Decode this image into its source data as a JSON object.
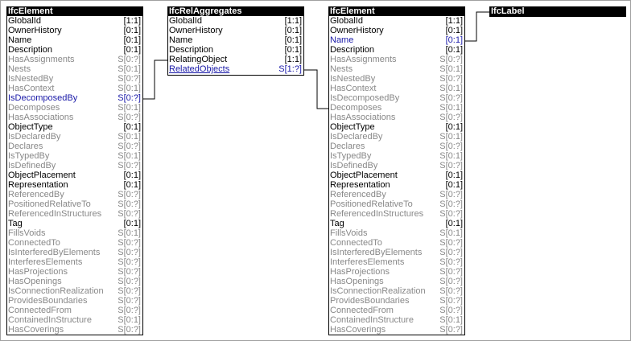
{
  "entities": [
    {
      "name": "IfcElement",
      "attributes": [
        {
          "name": "GlobalId",
          "card": "[1:1]",
          "kind": "direct"
        },
        {
          "name": "OwnerHistory",
          "card": "[0:1]",
          "kind": "direct"
        },
        {
          "name": "Name",
          "card": "[0:1]",
          "kind": "direct"
        },
        {
          "name": "Description",
          "card": "[0:1]",
          "kind": "direct"
        },
        {
          "name": "HasAssignments",
          "card": "S[0:?]",
          "kind": "inverse"
        },
        {
          "name": "Nests",
          "card": "S[0:1]",
          "kind": "inverse"
        },
        {
          "name": "IsNestedBy",
          "card": "S[0:?]",
          "kind": "inverse"
        },
        {
          "name": "HasContext",
          "card": "S[0:1]",
          "kind": "inverse"
        },
        {
          "name": "IsDecomposedBy",
          "card": "S[0:?]",
          "kind": "linked"
        },
        {
          "name": "Decomposes",
          "card": "S[0:1]",
          "kind": "inverse"
        },
        {
          "name": "HasAssociations",
          "card": "S[0:?]",
          "kind": "inverse"
        },
        {
          "name": "ObjectType",
          "card": "[0:1]",
          "kind": "direct"
        },
        {
          "name": "IsDeclaredBy",
          "card": "S[0:1]",
          "kind": "inverse"
        },
        {
          "name": "Declares",
          "card": "S[0:?]",
          "kind": "inverse"
        },
        {
          "name": "IsTypedBy",
          "card": "S[0:1]",
          "kind": "inverse"
        },
        {
          "name": "IsDefinedBy",
          "card": "S[0:?]",
          "kind": "inverse"
        },
        {
          "name": "ObjectPlacement",
          "card": "[0:1]",
          "kind": "direct"
        },
        {
          "name": "Representation",
          "card": "[0:1]",
          "kind": "direct"
        },
        {
          "name": "ReferencedBy",
          "card": "S[0:?]",
          "kind": "inverse"
        },
        {
          "name": "PositionedRelativeTo",
          "card": "S[0:?]",
          "kind": "inverse"
        },
        {
          "name": "ReferencedInStructures",
          "card": "S[0:?]",
          "kind": "inverse"
        },
        {
          "name": "Tag",
          "card": "[0:1]",
          "kind": "direct"
        },
        {
          "name": "FillsVoids",
          "card": "S[0:1]",
          "kind": "inverse"
        },
        {
          "name": "ConnectedTo",
          "card": "S[0:?]",
          "kind": "inverse"
        },
        {
          "name": "IsInterferedByElements",
          "card": "S[0:?]",
          "kind": "inverse"
        },
        {
          "name": "InterferesElements",
          "card": "S[0:?]",
          "kind": "inverse"
        },
        {
          "name": "HasProjections",
          "card": "S[0:?]",
          "kind": "inverse"
        },
        {
          "name": "HasOpenings",
          "card": "S[0:?]",
          "kind": "inverse"
        },
        {
          "name": "IsConnectionRealization",
          "card": "S[0:?]",
          "kind": "inverse"
        },
        {
          "name": "ProvidesBoundaries",
          "card": "S[0:?]",
          "kind": "inverse"
        },
        {
          "name": "ConnectedFrom",
          "card": "S[0:?]",
          "kind": "inverse"
        },
        {
          "name": "ContainedInStructure",
          "card": "S[0:1]",
          "kind": "inverse"
        },
        {
          "name": "HasCoverings",
          "card": "S[0:?]",
          "kind": "inverse"
        }
      ]
    },
    {
      "name": "IfcRelAggregates",
      "attributes": [
        {
          "name": "GlobalId",
          "card": "[1:1]",
          "kind": "direct"
        },
        {
          "name": "OwnerHistory",
          "card": "[0:1]",
          "kind": "direct"
        },
        {
          "name": "Name",
          "card": "[0:1]",
          "kind": "direct"
        },
        {
          "name": "Description",
          "card": "[0:1]",
          "kind": "direct"
        },
        {
          "name": "RelatingObject",
          "card": "[1:1]",
          "kind": "direct"
        },
        {
          "name": "RelatedObjects",
          "card": "S[1:?]",
          "kind": "linked-underlined"
        }
      ]
    },
    {
      "name": "IfcElement",
      "attributes": [
        {
          "name": "GlobalId",
          "card": "[1:1]",
          "kind": "direct"
        },
        {
          "name": "OwnerHistory",
          "card": "[0:1]",
          "kind": "direct"
        },
        {
          "name": "Name",
          "card": "[0:1]",
          "kind": "linked"
        },
        {
          "name": "Description",
          "card": "[0:1]",
          "kind": "direct"
        },
        {
          "name": "HasAssignments",
          "card": "S[0:?]",
          "kind": "inverse"
        },
        {
          "name": "Nests",
          "card": "S[0:1]",
          "kind": "inverse"
        },
        {
          "name": "IsNestedBy",
          "card": "S[0:?]",
          "kind": "inverse"
        },
        {
          "name": "HasContext",
          "card": "S[0:1]",
          "kind": "inverse"
        },
        {
          "name": "IsDecomposedBy",
          "card": "S[0:?]",
          "kind": "inverse"
        },
        {
          "name": "Decomposes",
          "card": "S[0:1]",
          "kind": "inverse"
        },
        {
          "name": "HasAssociations",
          "card": "S[0:?]",
          "kind": "inverse"
        },
        {
          "name": "ObjectType",
          "card": "[0:1]",
          "kind": "direct"
        },
        {
          "name": "IsDeclaredBy",
          "card": "S[0:1]",
          "kind": "inverse"
        },
        {
          "name": "Declares",
          "card": "S[0:?]",
          "kind": "inverse"
        },
        {
          "name": "IsTypedBy",
          "card": "S[0:1]",
          "kind": "inverse"
        },
        {
          "name": "IsDefinedBy",
          "card": "S[0:?]",
          "kind": "inverse"
        },
        {
          "name": "ObjectPlacement",
          "card": "[0:1]",
          "kind": "direct"
        },
        {
          "name": "Representation",
          "card": "[0:1]",
          "kind": "direct"
        },
        {
          "name": "ReferencedBy",
          "card": "S[0:?]",
          "kind": "inverse"
        },
        {
          "name": "PositionedRelativeTo",
          "card": "S[0:?]",
          "kind": "inverse"
        },
        {
          "name": "ReferencedInStructures",
          "card": "S[0:?]",
          "kind": "inverse"
        },
        {
          "name": "Tag",
          "card": "[0:1]",
          "kind": "direct"
        },
        {
          "name": "FillsVoids",
          "card": "S[0:1]",
          "kind": "inverse"
        },
        {
          "name": "ConnectedTo",
          "card": "S[0:?]",
          "kind": "inverse"
        },
        {
          "name": "IsInterferedByElements",
          "card": "S[0:?]",
          "kind": "inverse"
        },
        {
          "name": "InterferesElements",
          "card": "S[0:?]",
          "kind": "inverse"
        },
        {
          "name": "HasProjections",
          "card": "S[0:?]",
          "kind": "inverse"
        },
        {
          "name": "HasOpenings",
          "card": "S[0:?]",
          "kind": "inverse"
        },
        {
          "name": "IsConnectionRealization",
          "card": "S[0:?]",
          "kind": "inverse"
        },
        {
          "name": "ProvidesBoundaries",
          "card": "S[0:?]",
          "kind": "inverse"
        },
        {
          "name": "ConnectedFrom",
          "card": "S[0:?]",
          "kind": "inverse"
        },
        {
          "name": "ContainedInStructure",
          "card": "S[0:1]",
          "kind": "inverse"
        },
        {
          "name": "HasCoverings",
          "card": "S[0:?]",
          "kind": "inverse"
        }
      ]
    },
    {
      "name": "IfcLabel",
      "attributes": []
    }
  ],
  "relations": [
    {
      "from": "IfcElement.IsDecomposedBy",
      "to": "IfcRelAggregates.RelatingObject"
    },
    {
      "from": "IfcRelAggregates.RelatedObjects",
      "to": "IfcElement.Decomposes"
    },
    {
      "from": "IfcElement.Name",
      "to": "IfcLabel"
    }
  ],
  "colors": {
    "header_bg": "#000000",
    "header_text": "#ffffff",
    "direct_attr": "#000000",
    "inverse_attr": "#888888",
    "linked_attr": "#1a1aa8"
  }
}
